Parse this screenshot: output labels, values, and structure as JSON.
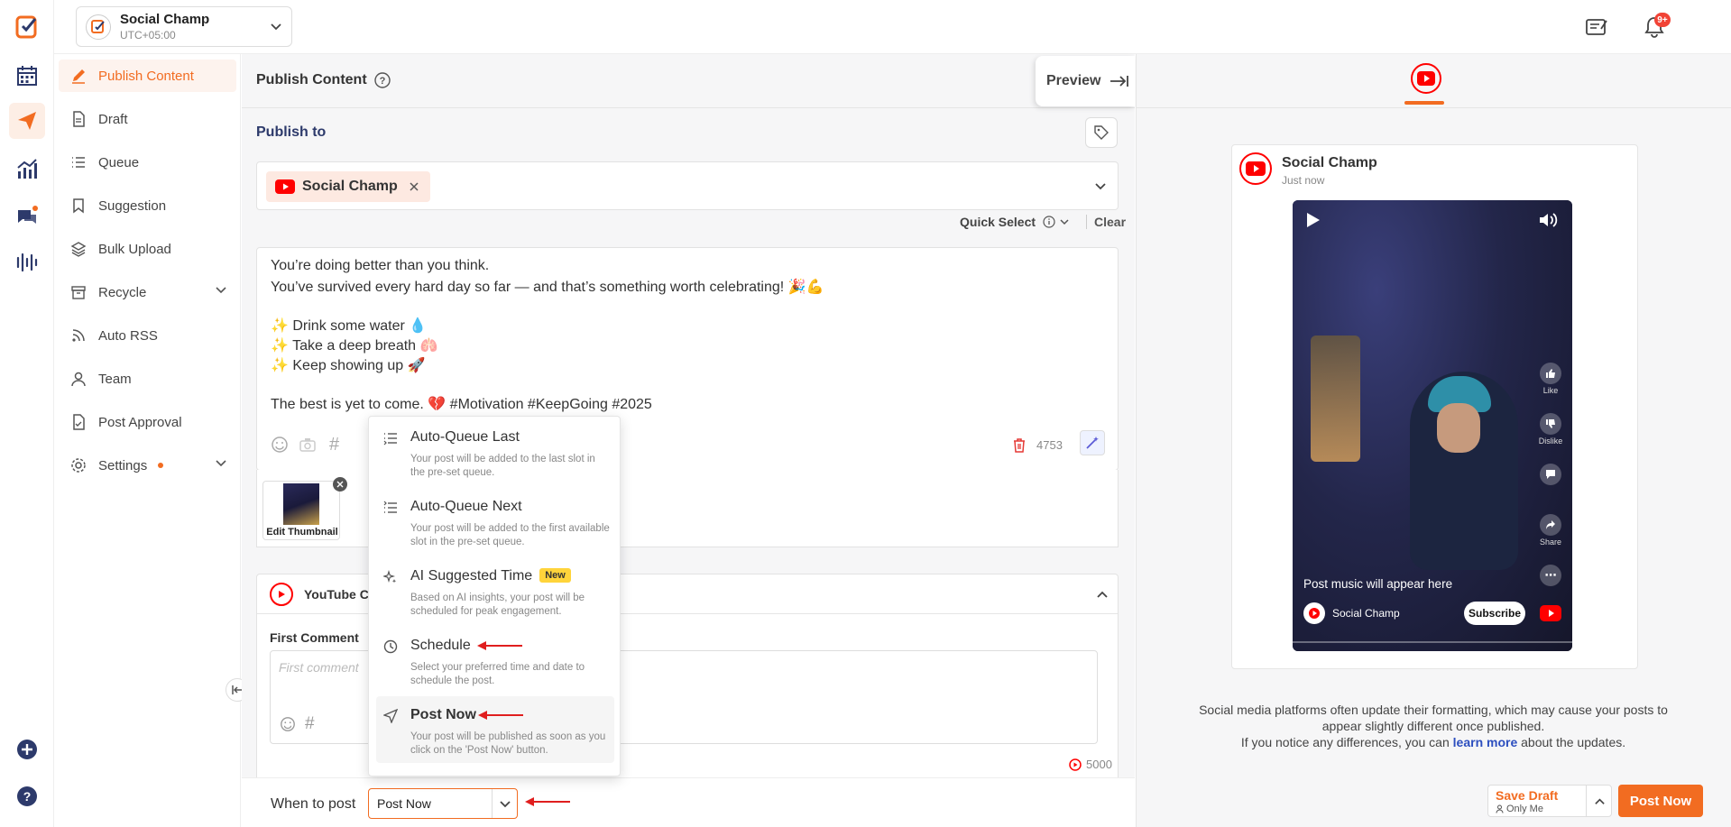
{
  "account": {
    "name": "Social Champ",
    "timezone": "UTC+05:00"
  },
  "topbar": {
    "notification_count": "9+"
  },
  "sidebar": {
    "items": [
      {
        "label": "Publish Content",
        "active": true
      },
      {
        "label": "Draft"
      },
      {
        "label": "Queue"
      },
      {
        "label": "Suggestion"
      },
      {
        "label": "Bulk Upload"
      },
      {
        "label": "Recycle"
      },
      {
        "label": "Auto RSS"
      },
      {
        "label": "Team"
      },
      {
        "label": "Post Approval"
      },
      {
        "label": "Settings"
      }
    ]
  },
  "main": {
    "title": "Publish Content",
    "preview_toggle": "Preview",
    "publish_to_label": "Publish to",
    "selected_account": "Social Champ",
    "quick_select": "Quick Select",
    "clear": "Clear",
    "caption_lines": [
      "You’re doing better than you think.",
      "You’ve survived every hard day so far — and that’s something worth celebrating! 🎉💪",
      "",
      "✨ Drink some water 💧",
      "✨ Take a deep breath 🫁",
      "✨ Keep showing up 🚀",
      "",
      "The best is yet to come. 💔 #Motivation #KeepGoing #2025"
    ],
    "char_count": "4753",
    "edit_thumbnail": "Edit Thumbnail",
    "youtube_panel_title": "YouTube C",
    "first_comment_label": "First Comment",
    "first_comment_placeholder": "First comment",
    "comment_char_count": "5000",
    "when_label": "When to post",
    "when_value": "Post Now"
  },
  "schedule_menu": {
    "options": [
      {
        "title": "Auto-Queue Last",
        "desc": "Your post will be added to the last slot in the pre-set queue.",
        "icon": "list-end-icon"
      },
      {
        "title": "Auto-Queue Next",
        "desc": "Your post will be added to the first available slot in the pre-set queue.",
        "icon": "list-start-icon"
      },
      {
        "title": "AI Suggested Time",
        "badge": "New",
        "desc": "Based on AI insights, your post will be scheduled for peak engagement.",
        "icon": "sparkle-icon"
      },
      {
        "title": "Schedule",
        "desc": "Select your preferred time and date to schedule the post.",
        "icon": "clock-icon"
      },
      {
        "title": "Post Now",
        "desc": "Your post will be published as soon as you click on the 'Post Now' button.",
        "icon": "send-icon",
        "highlighted": true
      }
    ]
  },
  "preview": {
    "account_name": "Social Champ",
    "time": "Just now",
    "music_text": "Post music will appear here",
    "channel_name": "Social Champ",
    "subscribe": "Subscribe",
    "side_labels": [
      "Like",
      "Dislike",
      "",
      "Share",
      ""
    ],
    "note_line1": "Social media platforms often update their formatting, which may cause your posts to appear slightly different once published.",
    "note_line2_prefix": "If you notice any differences, you can ",
    "note_link": "learn more",
    "note_line2_suffix": " about the updates."
  },
  "actions": {
    "save_draft": "Save Draft",
    "save_draft_sub": "Only Me",
    "post_now": "Post Now"
  },
  "colors": {
    "accent": "#f26c21",
    "youtube_red": "#ff0000",
    "nav_blue": "#2d3a6b",
    "annotation_red": "#e01e1e"
  }
}
